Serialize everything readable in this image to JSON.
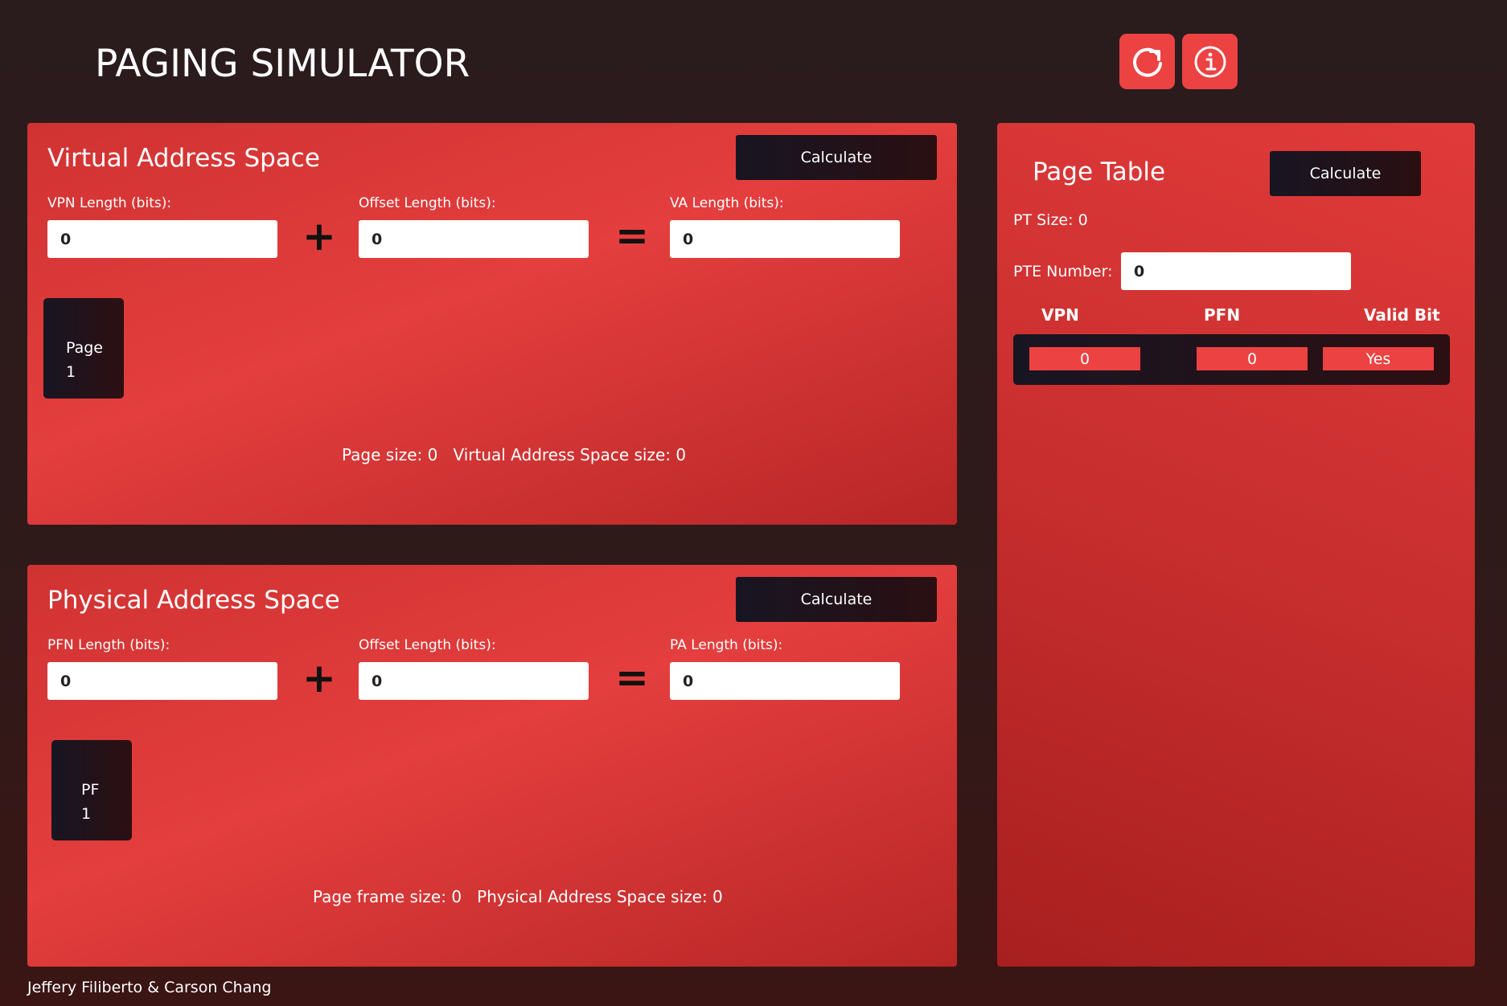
{
  "header": {
    "title": "PAGING SIMULATOR",
    "reset_icon": "refresh-icon",
    "info_icon": "info-icon",
    "accent_color": "#ec4242"
  },
  "virtual": {
    "title": "Virtual Address Space",
    "calculate_label": "Calculate",
    "vpn_label": "VPN Length (bits):",
    "vpn_value": "0",
    "offset_label": "Offset Length (bits):",
    "offset_value": "0",
    "va_label": "VA Length (bits):",
    "va_value": "0",
    "plus": "+",
    "equals": "=",
    "tile_label": "Page",
    "tile_number": "1",
    "page_size_label": "Page size:",
    "page_size_value": "0",
    "space_size_label": "Virtual Address Space size:",
    "space_size_value": "0"
  },
  "physical": {
    "title": "Physical Address Space",
    "calculate_label": "Calculate",
    "pfn_label": "PFN Length (bits):",
    "pfn_value": "0",
    "offset_label": "Offset Length (bits):",
    "offset_value": "0",
    "pa_label": "PA Length (bits):",
    "pa_value": "0",
    "plus": "+",
    "equals": "=",
    "tile_label": "PF",
    "tile_number": "1",
    "frame_size_label": "Page frame size:",
    "frame_size_value": "0",
    "space_size_label": "Physical Address Space size:",
    "space_size_value": "0"
  },
  "page_table": {
    "title": "Page Table",
    "calculate_label": "Calculate",
    "pt_size_label": "PT Size:",
    "pt_size_value": "0",
    "pte_number_label": "PTE Number:",
    "pte_number_value": "0",
    "columns": [
      "VPN",
      "PFN",
      "Valid Bit"
    ],
    "rows": [
      {
        "vpn": "0",
        "pfn": "0",
        "valid": "Yes"
      }
    ]
  },
  "footer": {
    "credits": "Jeffery Filiberto & Carson Chang"
  }
}
